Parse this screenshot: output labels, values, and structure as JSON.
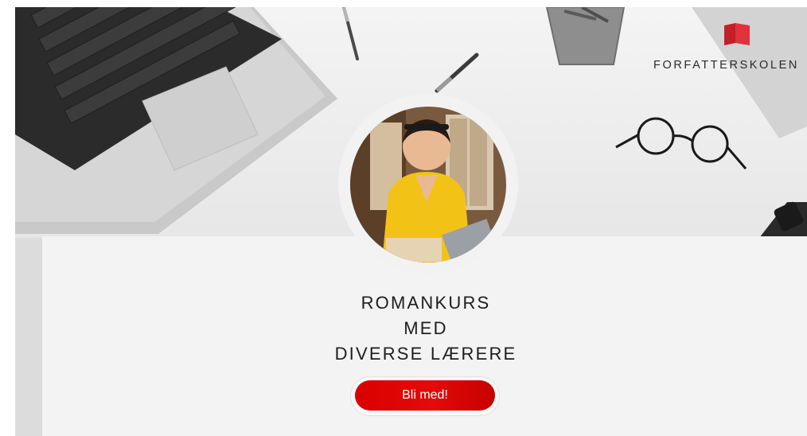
{
  "brand": {
    "name": "FORFATTERSKOLEN",
    "color": "#d7262e"
  },
  "course": {
    "title_lines": [
      "ROMANKURS",
      "MED",
      "DIVERSE LÆRERE"
    ]
  },
  "cta": {
    "label": "Bli med!",
    "color": "#e00000"
  },
  "hero": {
    "objects": [
      "laptop",
      "pen",
      "pencil-cup",
      "glasses",
      "smartwatch"
    ]
  },
  "avatar": {
    "description_icon": "teacher-photo"
  }
}
